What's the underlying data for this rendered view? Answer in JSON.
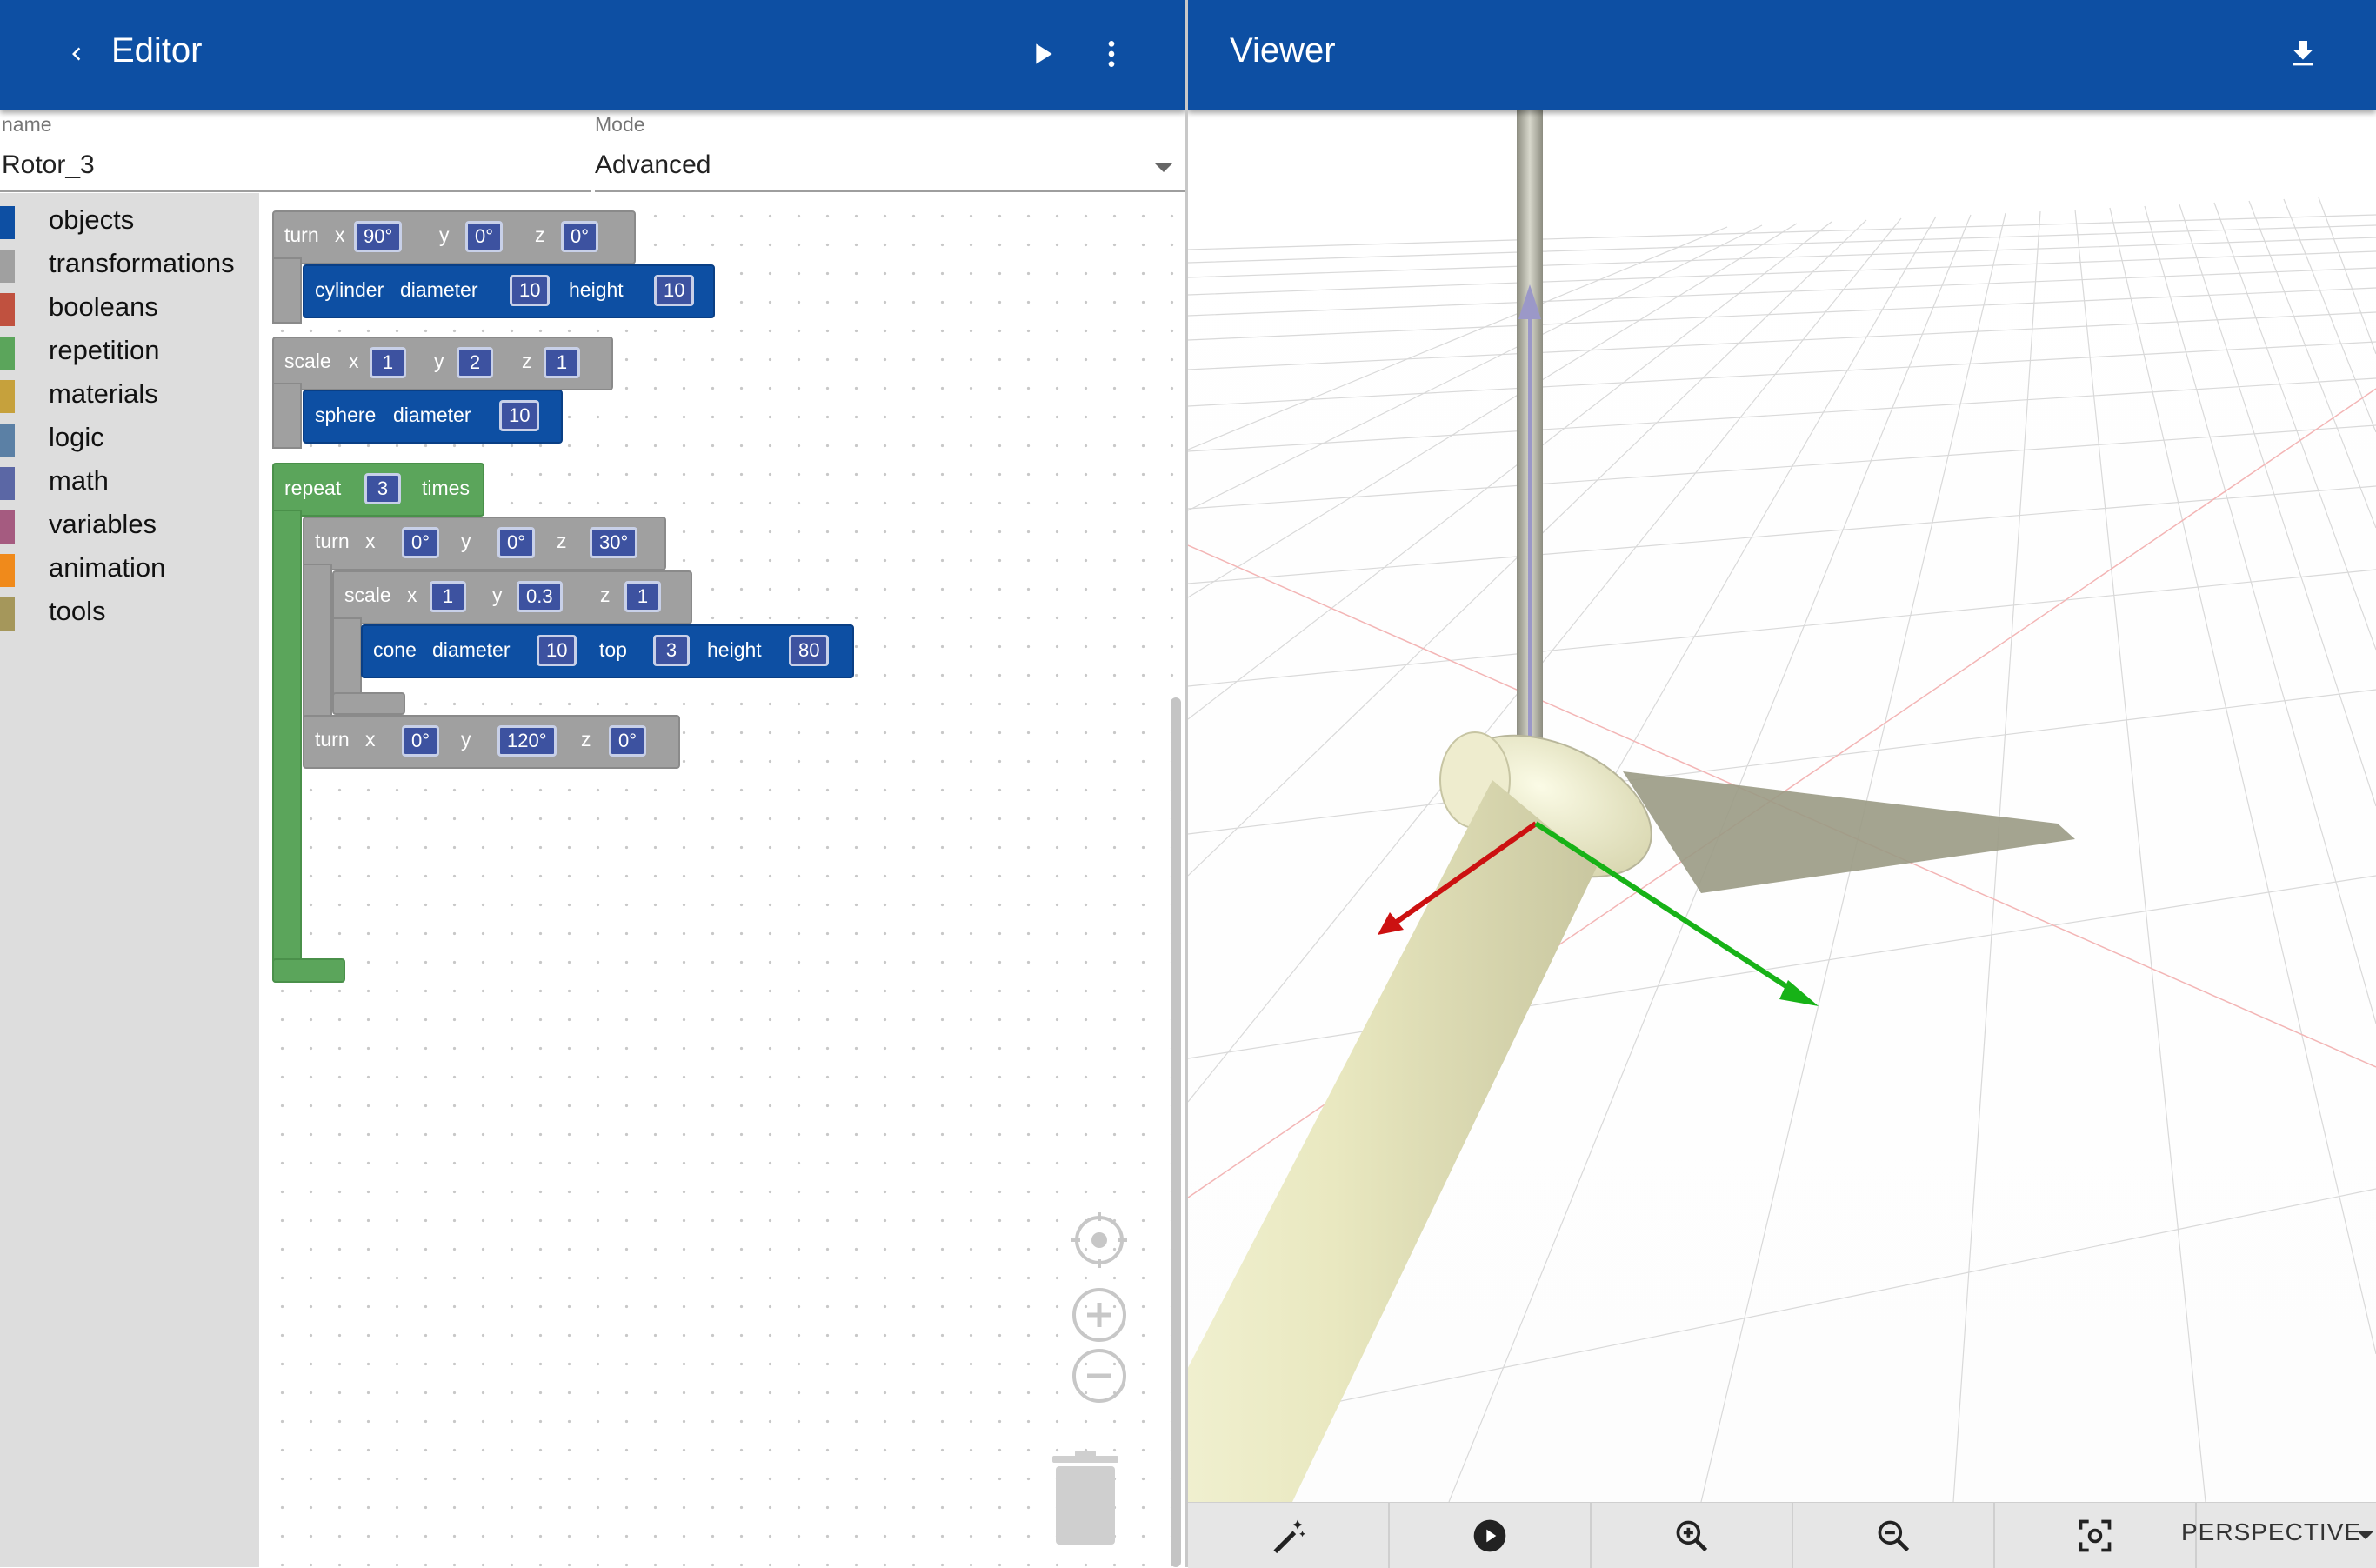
{
  "editor": {
    "title": "Editor",
    "back_icon": "chevron-left-icon",
    "run_icon": "play-icon",
    "more_icon": "more-vert-icon"
  },
  "viewer": {
    "title": "Viewer",
    "download_icon": "download-icon"
  },
  "form": {
    "name_label": "name",
    "name_value": "Rotor_3",
    "mode_label": "Mode",
    "mode_value": "Advanced"
  },
  "toolbox": {
    "items": [
      {
        "label": "objects",
        "color": "#0d4fa3"
      },
      {
        "label": "transformations",
        "color": "#a0a0a0"
      },
      {
        "label": "booleans",
        "color": "#c0513f"
      },
      {
        "label": "repetition",
        "color": "#5ba55b"
      },
      {
        "label": "materials",
        "color": "#c6a13c"
      },
      {
        "label": "logic",
        "color": "#5b80a5"
      },
      {
        "label": "math",
        "color": "#5b67a5"
      },
      {
        "label": "variables",
        "color": "#a55b80"
      },
      {
        "label": "animation",
        "color": "#f08a1b"
      },
      {
        "label": "tools",
        "color": "#a5975b"
      }
    ]
  },
  "blocks": {
    "turn1": {
      "name": "turn",
      "x_label": "x",
      "x": "90°",
      "y_label": "y",
      "y": "0°",
      "z_label": "z",
      "z": "0°"
    },
    "cylinder": {
      "name": "cylinder",
      "p1_label": "diameter",
      "p1": "10",
      "p2_label": "height",
      "p2": "10"
    },
    "scale1": {
      "name": "scale",
      "x_label": "x",
      "x": "1",
      "y_label": "y",
      "y": "2",
      "z_label": "z",
      "z": "1"
    },
    "sphere": {
      "name": "sphere",
      "p1_label": "diameter",
      "p1": "10"
    },
    "repeat": {
      "name": "repeat",
      "count": "3",
      "suffix": "times"
    },
    "turn2": {
      "name": "turn",
      "x_label": "x",
      "x": "0°",
      "y_label": "y",
      "y": "0°",
      "z_label": "z",
      "z": "30°"
    },
    "scale2": {
      "name": "scale",
      "x_label": "x",
      "x": "1",
      "y_label": "y",
      "y": "0.3",
      "z_label": "z",
      "z": "1"
    },
    "cone": {
      "name": "cone",
      "p1_label": "diameter",
      "p1": "10",
      "p2_label": "top",
      "p2": "3",
      "p3_label": "height",
      "p3": "80"
    },
    "turn3": {
      "name": "turn",
      "x_label": "x",
      "x": "0°",
      "y_label": "y",
      "y": "120°",
      "z_label": "z",
      "z": "0°"
    }
  },
  "workspace_controls": {
    "center_icon": "recenter-icon",
    "zoom_in_icon": "zoom-in-icon",
    "zoom_out_icon": "zoom-out-icon",
    "trash_icon": "trash-icon"
  },
  "viewer_toolbar": {
    "buttons": [
      "magic-wand-icon",
      "play-circle-icon",
      "zoom-in-icon",
      "zoom-out-icon",
      "focus-icon"
    ],
    "camera_mode": "PERSPECTIVE"
  }
}
